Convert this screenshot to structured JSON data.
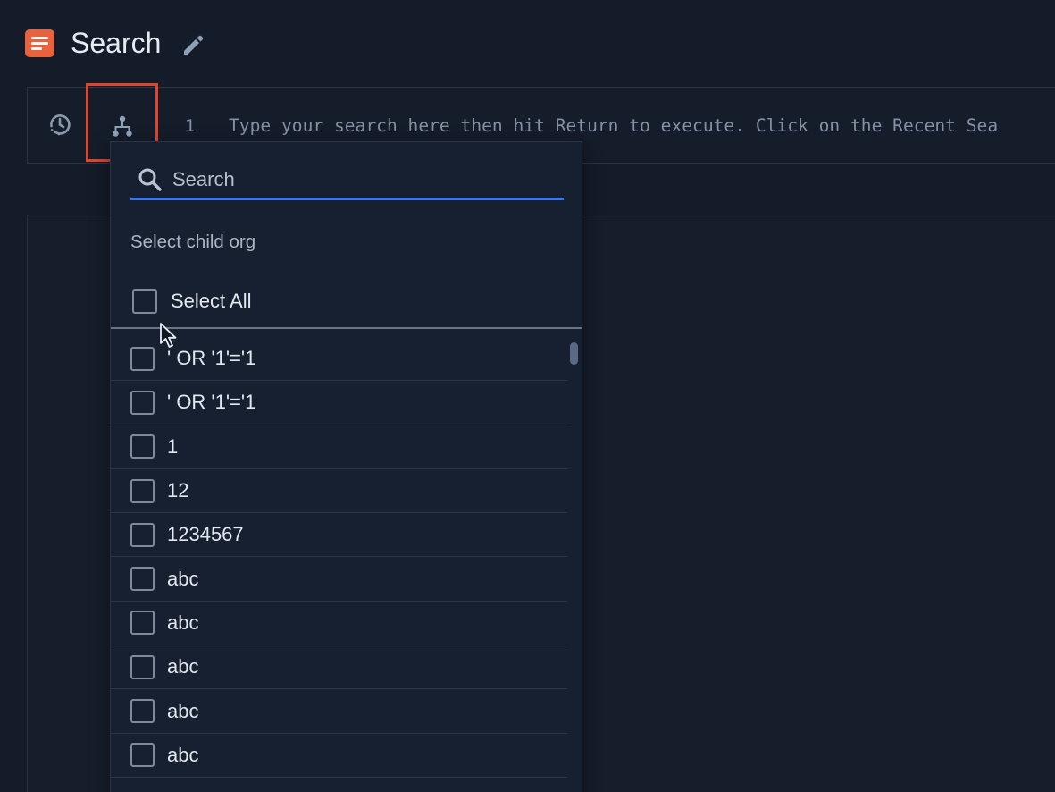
{
  "header": {
    "title": "Search"
  },
  "query_bar": {
    "line_number": "1",
    "placeholder": "Type your search here then hit Return to execute. Click on the Recent Sea"
  },
  "dropdown": {
    "search_placeholder": "Search",
    "section_label": "Select child org",
    "select_all_label": "Select All",
    "items": [
      {
        "label": "' OR '1'='1"
      },
      {
        "label": "' OR '1'='1"
      },
      {
        "label": "1"
      },
      {
        "label": "12"
      },
      {
        "label": "1234567"
      },
      {
        "label": "abc"
      },
      {
        "label": "abc"
      },
      {
        "label": "abc"
      },
      {
        "label": "abc"
      },
      {
        "label": "abc"
      }
    ]
  },
  "colors": {
    "accent": "#3b78e7",
    "brand": "#e8623d",
    "highlight": "#e0452d"
  }
}
